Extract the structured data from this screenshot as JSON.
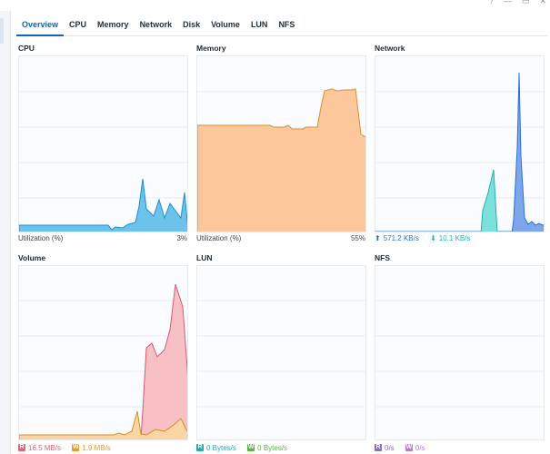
{
  "window": {
    "help_icon": "?",
    "minimize_icon": "—",
    "maximize_icon": "▭",
    "close_icon": "✕"
  },
  "tabs": [
    "Overview",
    "CPU",
    "Memory",
    "Network",
    "Disk",
    "Volume",
    "LUN",
    "NFS"
  ],
  "panels": {
    "cpu": {
      "title": "CPU",
      "label": "Utilization  (%)",
      "value": "3%"
    },
    "memory": {
      "title": "Memory",
      "label": "Utilization  (%)",
      "value": "55%"
    },
    "network": {
      "title": "Network",
      "upload": "571.2 KB/s",
      "download": "10.1 KB/s"
    },
    "volume": {
      "title": "Volume",
      "read_badge": "R",
      "read": "16.5 MB/s",
      "write_badge": "W",
      "write": "1.9 MB/s"
    },
    "lun": {
      "title": "LUN",
      "read_badge": "R",
      "read": "0 Bytes/s",
      "write_badge": "W",
      "write": "0 Bytes/s"
    },
    "nfs": {
      "title": "NFS",
      "read_badge": "R",
      "read": "0/s",
      "write_badge": "W",
      "write": "0/s"
    }
  },
  "colors": {
    "accent": "#0b67c2",
    "cpu": "#1a8fd1",
    "memory": "#f39c3e",
    "net_up": "#2a6fd6",
    "net_down": "#1bb5b0",
    "vol_read": "#e06478",
    "vol_write": "#e5992e",
    "lun_read": "#25a8b0",
    "lun_write": "#58b244",
    "nfs_read": "#8e6cc4",
    "nfs_write": "#b27bd1"
  }
}
